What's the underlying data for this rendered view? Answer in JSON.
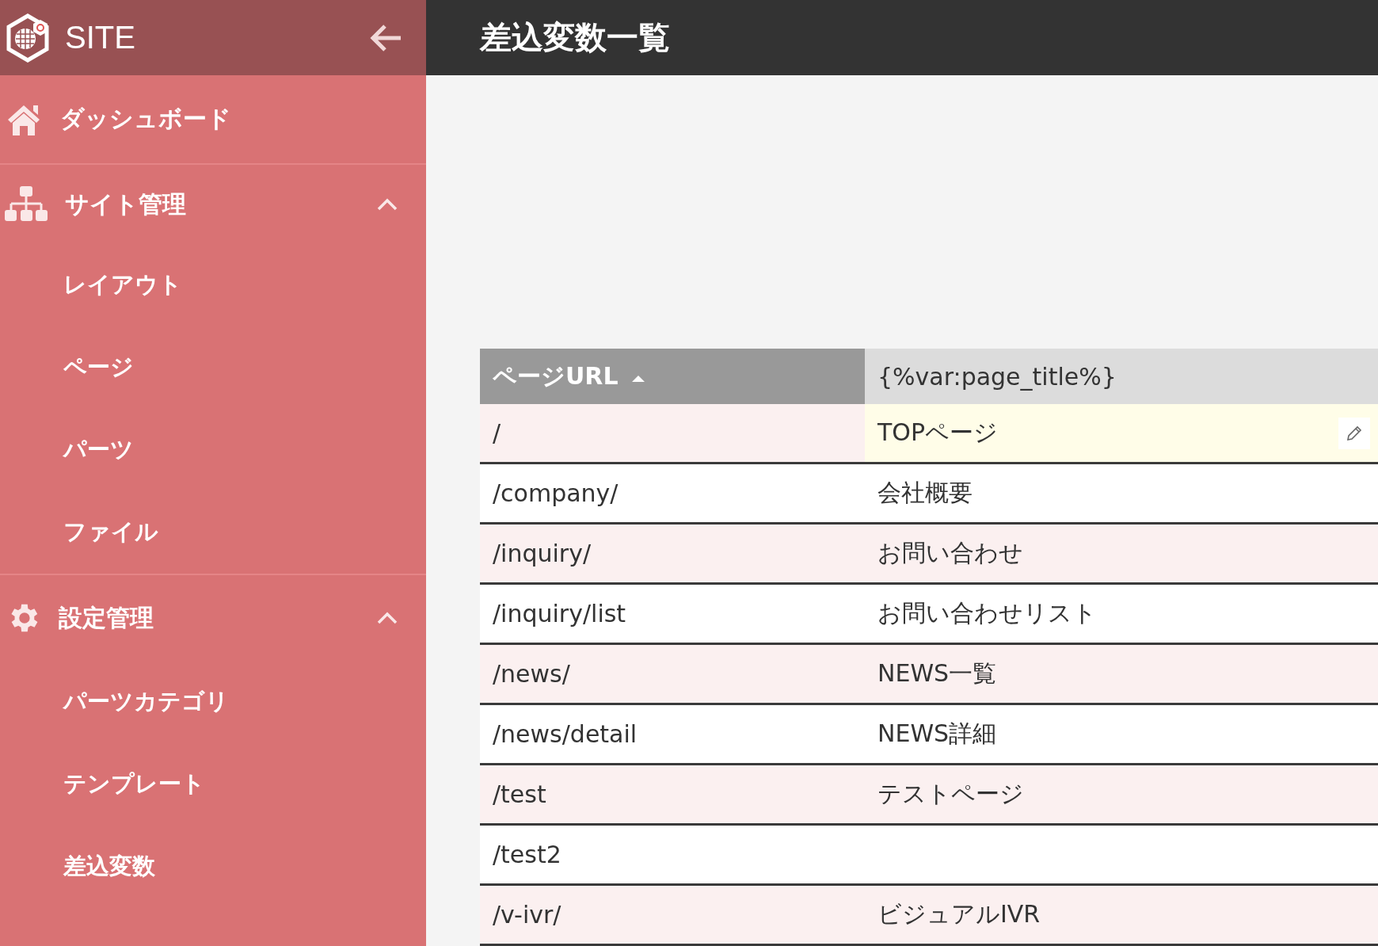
{
  "sidebar": {
    "title": "SITE",
    "items": [
      {
        "kind": "link",
        "label": "ダッシュボード"
      },
      {
        "kind": "section",
        "label": "サイト管理",
        "expanded": true,
        "children": [
          {
            "label": "レイアウト"
          },
          {
            "label": "ページ"
          },
          {
            "label": "パーツ"
          },
          {
            "label": "ファイル"
          }
        ]
      },
      {
        "kind": "section",
        "label": "設定管理",
        "expanded": true,
        "children": [
          {
            "label": "パーツカテゴリ"
          },
          {
            "label": "テンプレート"
          },
          {
            "label": "差込変数"
          }
        ]
      }
    ]
  },
  "header": {
    "title": "差込変数一覧"
  },
  "table": {
    "columns": [
      {
        "label": "ページURL",
        "sorted": true
      },
      {
        "label": "{%var:page_title%}",
        "sorted": false
      }
    ],
    "rows": [
      {
        "url": "/",
        "value": "TOPページ",
        "selected": true
      },
      {
        "url": "/company/",
        "value": "会社概要",
        "selected": false
      },
      {
        "url": "/inquiry/",
        "value": "お問い合わせ",
        "selected": false
      },
      {
        "url": "/inquiry/list",
        "value": "お問い合わせリスト",
        "selected": false
      },
      {
        "url": "/news/",
        "value": "NEWS一覧",
        "selected": false
      },
      {
        "url": "/news/detail",
        "value": "NEWS詳細",
        "selected": false
      },
      {
        "url": "/test",
        "value": "テストページ",
        "selected": false
      },
      {
        "url": "/test2",
        "selected": false
      },
      {
        "url": "/v-ivr/",
        "value": "ビジュアルIVR",
        "selected": false
      }
    ]
  }
}
